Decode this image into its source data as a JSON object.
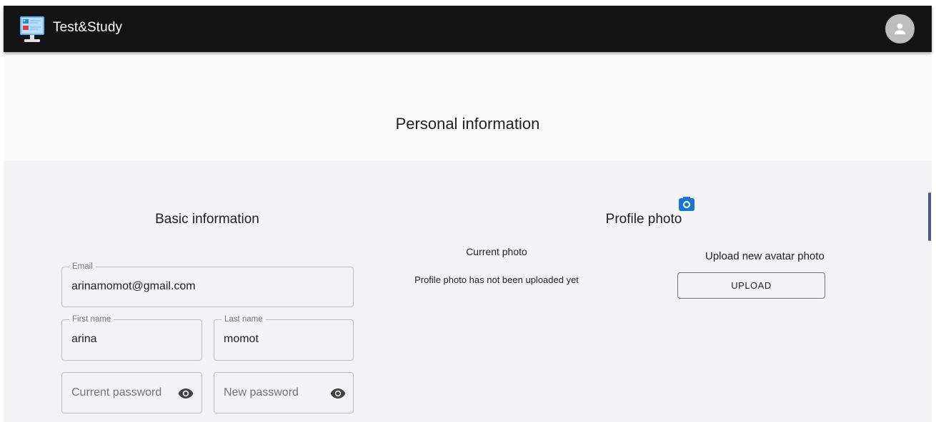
{
  "app": {
    "title": "Test&Study"
  },
  "page": {
    "title": "Personal information"
  },
  "basic_info": {
    "title": "Basic information",
    "email": {
      "label": "Email",
      "value": "arinamomot@gmail.com"
    },
    "first_name": {
      "label": "First name",
      "value": "arina"
    },
    "last_name": {
      "label": "Last name",
      "value": "momot"
    },
    "current_password": {
      "placeholder": "Current password"
    },
    "new_password": {
      "placeholder": "New password"
    }
  },
  "profile_photo": {
    "title": "Profile photo",
    "current_photo_label": "Current photo",
    "no_photo_text": "Profile photo has not been uploaded yet",
    "upload_heading": "Upload new avatar photo",
    "upload_button": "UPLOAD"
  },
  "colors": {
    "appbar": "#141414",
    "accent": "#1976d2",
    "page_bg": "#f4f4f6"
  },
  "icons": {
    "logo": "computer-quiz-logo-icon",
    "avatar": "account-icon",
    "eye": "visibility-icon",
    "camera": "camera-icon"
  }
}
